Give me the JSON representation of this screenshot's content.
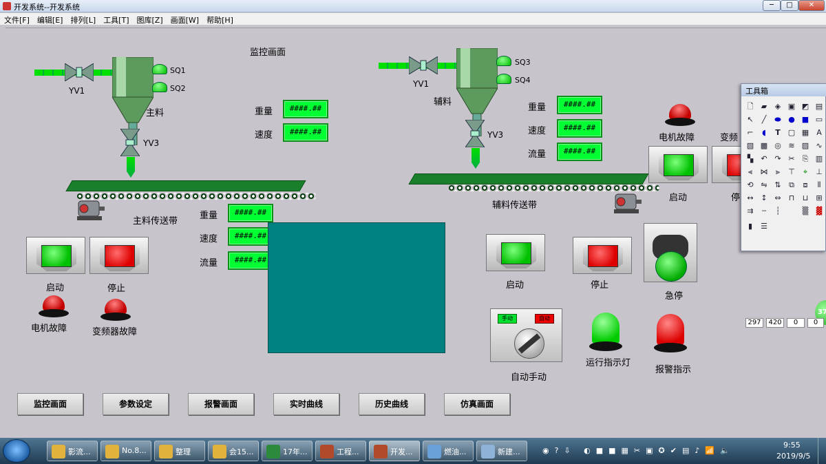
{
  "window": {
    "title": "开发系统--开发系统",
    "min": "─",
    "max": "□",
    "close": "✕"
  },
  "menu": [
    "文件[F]",
    "编辑[E]",
    "排列[L]",
    "工具[T]",
    "图库[Z]",
    "画面[W]",
    "帮助[H]"
  ],
  "screen": {
    "title": "监控画面",
    "main": {
      "valve_in": "YV1",
      "sensor1": "SQ1",
      "sensor2": "SQ2",
      "hopper_label": "主料",
      "valve_out": "YV3",
      "belt_label": "主料传送带",
      "weight_label": "重量",
      "weight_value": "####.##",
      "speed_label": "速度",
      "speed_value": "####.##",
      "belt_weight_label": "重量",
      "belt_weight_value": "####.##",
      "belt_speed_label": "速度",
      "belt_speed_value": "####.##",
      "belt_flow_label": "流量",
      "belt_flow_value": "####.##",
      "start_label": "启动",
      "stop_label": "停止",
      "motor_fault_label": "电机故障",
      "inverter_fault_label": "变频器故障"
    },
    "aux": {
      "valve_in": "YV1",
      "sensor1": "SQ3",
      "sensor2": "SQ4",
      "hopper_label": "辅料",
      "valve_out": "YV3",
      "belt_label": "辅料传送带",
      "weight_label": "重量",
      "weight_value": "####.##",
      "speed_label": "速度",
      "speed_value": "####.##",
      "flow_label": "流量",
      "flow_value": "####.##",
      "start_label": "启动",
      "stop_label": "停止",
      "motor_fault_label": "电机故障",
      "inverter_fault_label": "变频",
      "start2_label": "启动",
      "stop2_label": "停"
    },
    "estop_label": "急停",
    "mode": {
      "manual": "手动",
      "auto": "自动",
      "label": "自动手动"
    },
    "run_lamp_label": "运行指示灯",
    "alarm_lamp_label": "报警指示",
    "nav": [
      "监控画面",
      "参数设定",
      "报警画面",
      "实时曲线",
      "历史曲线",
      "仿真画面"
    ],
    "side_badge": "37"
  },
  "toolbox": {
    "title": "工具箱",
    "fields": [
      "297",
      "420",
      "0",
      "0"
    ]
  },
  "taskbar": {
    "items": [
      "影流...",
      "No.8...",
      "整理",
      "会15...",
      "17年...",
      "工程...",
      "开发...",
      "燃油...",
      "新建..."
    ],
    "time": "9:55",
    "date": "2019/9/5"
  },
  "colors": {
    "indicator": "#00ff33",
    "panel": "#008080",
    "belt": "#1a7f2a"
  }
}
